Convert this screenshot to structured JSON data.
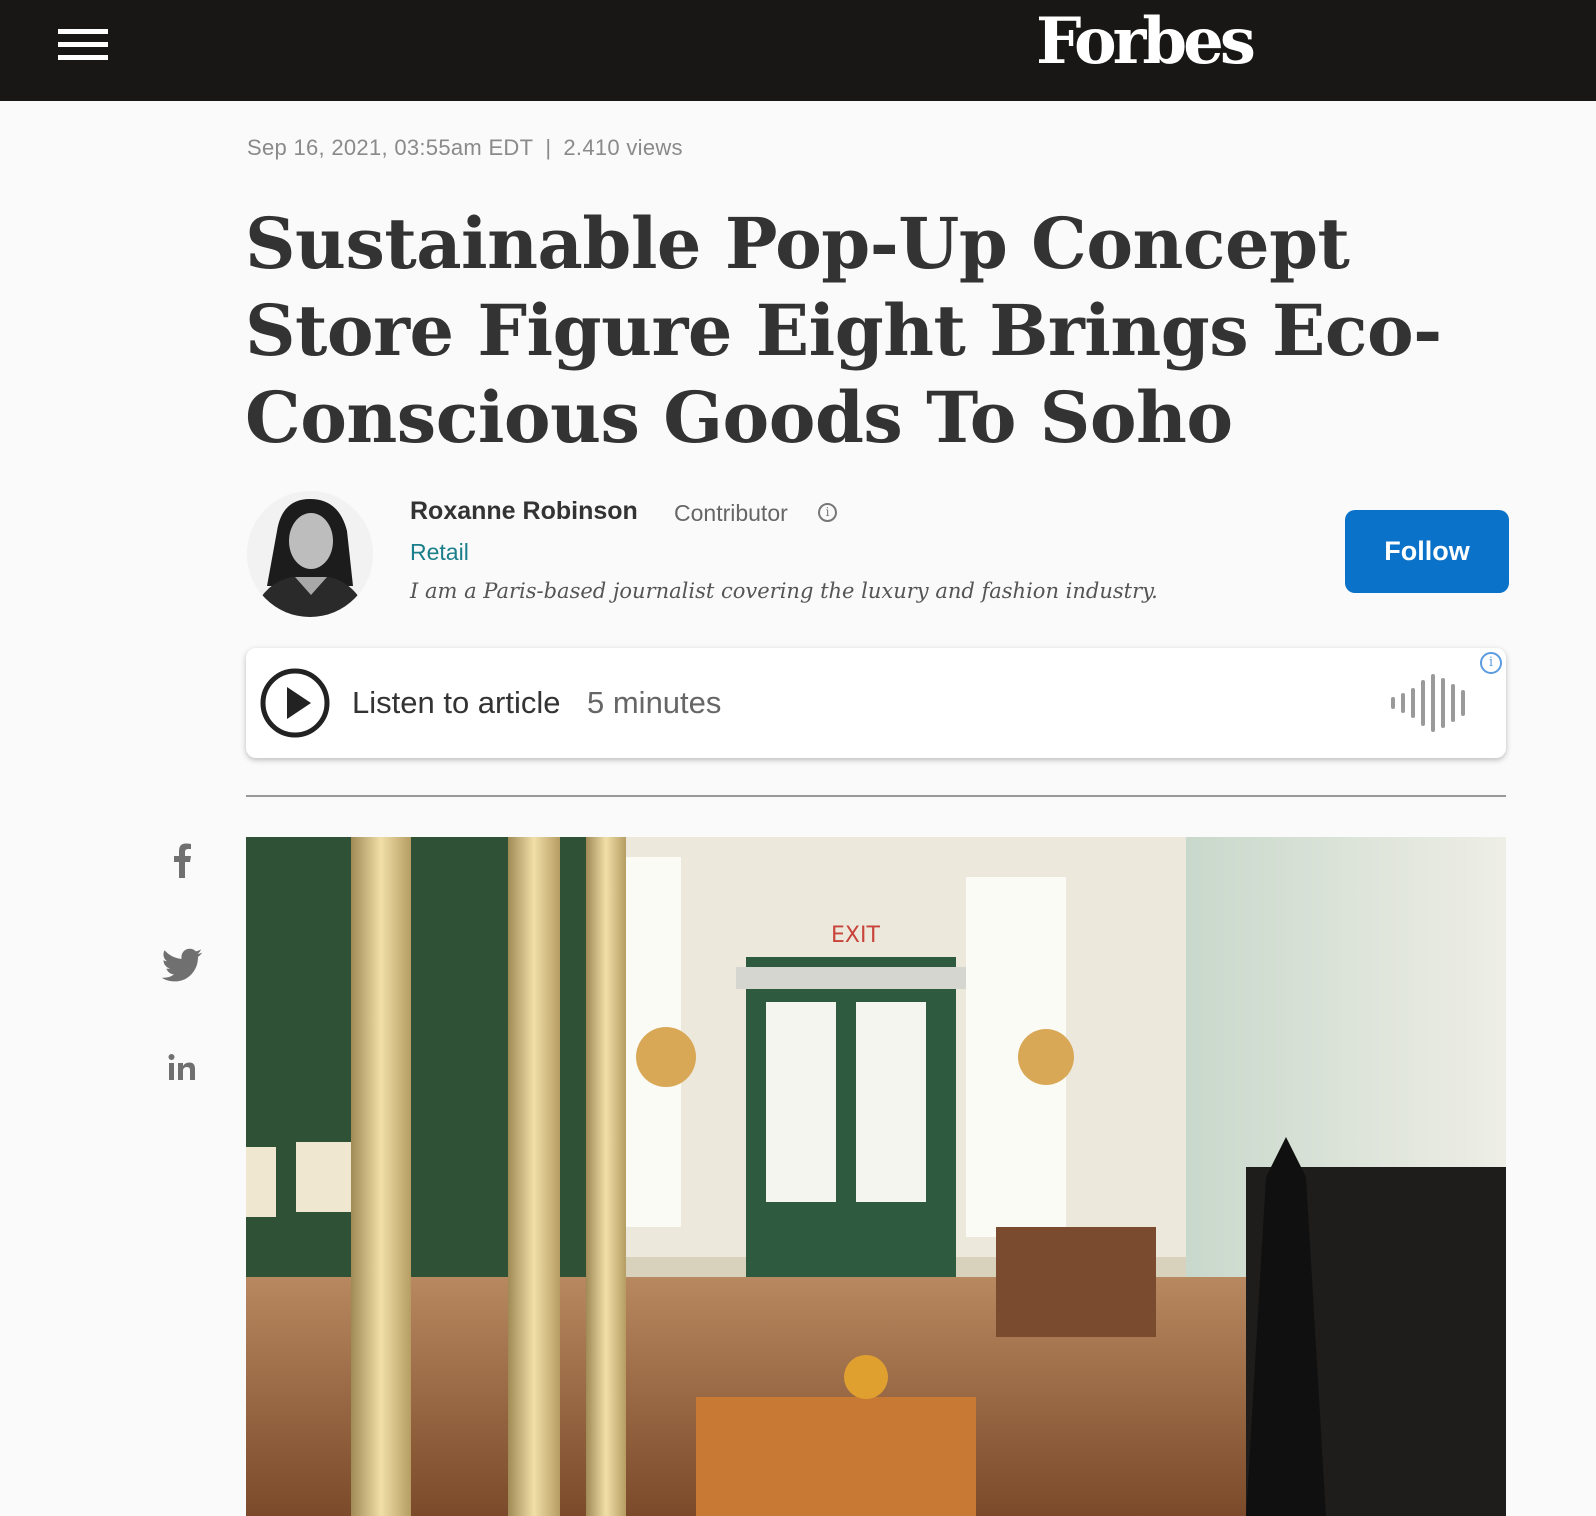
{
  "header": {
    "menu_icon": "hamburger-icon",
    "logo": "Forbes"
  },
  "article": {
    "timestamp": "Sep 16, 2021, 03:55am EDT",
    "separator": "|",
    "views": "2.410 views",
    "headline": "Sustainable Pop-Up Concept Store Figure Eight Brings Eco-Conscious Goods To Soho"
  },
  "author": {
    "name": "Roxanne Robinson",
    "role": "Contributor",
    "info_icon": "i",
    "channel": "Retail",
    "bio": "I am a Paris-based journalist covering the luxury and fashion industry.",
    "follow_label": "Follow"
  },
  "audio": {
    "listen_label": "Listen to article",
    "duration": "5 minutes",
    "info_icon": "i",
    "accent_color": "#5b9be0"
  },
  "share": {
    "icons": [
      "facebook-icon",
      "twitter-icon",
      "linkedin-icon"
    ]
  },
  "colors": {
    "topbar": "#181716",
    "follow_button": "#0b72c9",
    "channel_link": "#1a7f8a"
  }
}
